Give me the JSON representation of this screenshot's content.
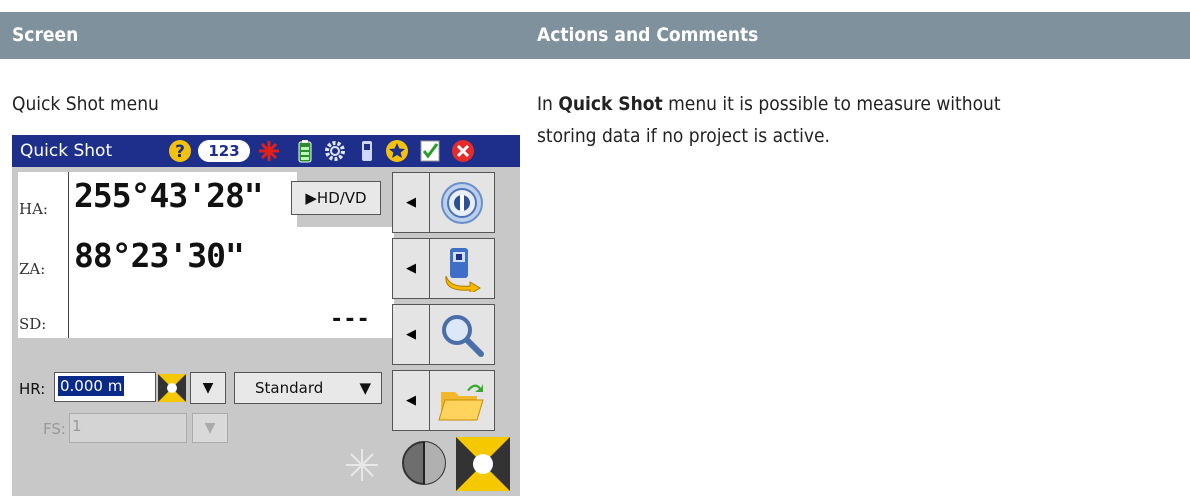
{
  "header": {
    "col_screen": "Screen",
    "col_actions": "Actions and Comments"
  },
  "row": {
    "screen_caption": "Quick Shot menu",
    "comment_prefix": "In ",
    "comment_bold": "Quick Shot",
    "comment_line1_rest": " menu it is possible to measure without",
    "comment_line2": "storing data if no project is active."
  },
  "device": {
    "title": "Quick Shot",
    "title_icons": [
      "help-icon",
      "numeric-mode-icon",
      "laser-pointer-icon",
      "battery-icon",
      "settings-icon",
      "instrument-icon",
      "favorites-icon",
      "accept-icon",
      "close-icon"
    ],
    "numeric_mode_label": "123",
    "ha_label": "HA:",
    "ha_value": "255°43'28\"",
    "za_label": "ZA:",
    "za_value": "88°23'30\"",
    "sd_label": "SD:",
    "sd_value": "---",
    "hdvd_button": "▶HD/VD",
    "hr_label": "HR:",
    "hr_value": "0.000 m",
    "mode_select": "Standard",
    "fs_label": "FS:",
    "fs_value": "1",
    "side_buttons": [
      "target-icon",
      "device-transfer-icon",
      "search-icon",
      "open-folder-icon"
    ],
    "colors": {
      "title_bar": "#1d2f8a",
      "header_bar": "#80919e",
      "selection": "#0a2a8a"
    }
  }
}
